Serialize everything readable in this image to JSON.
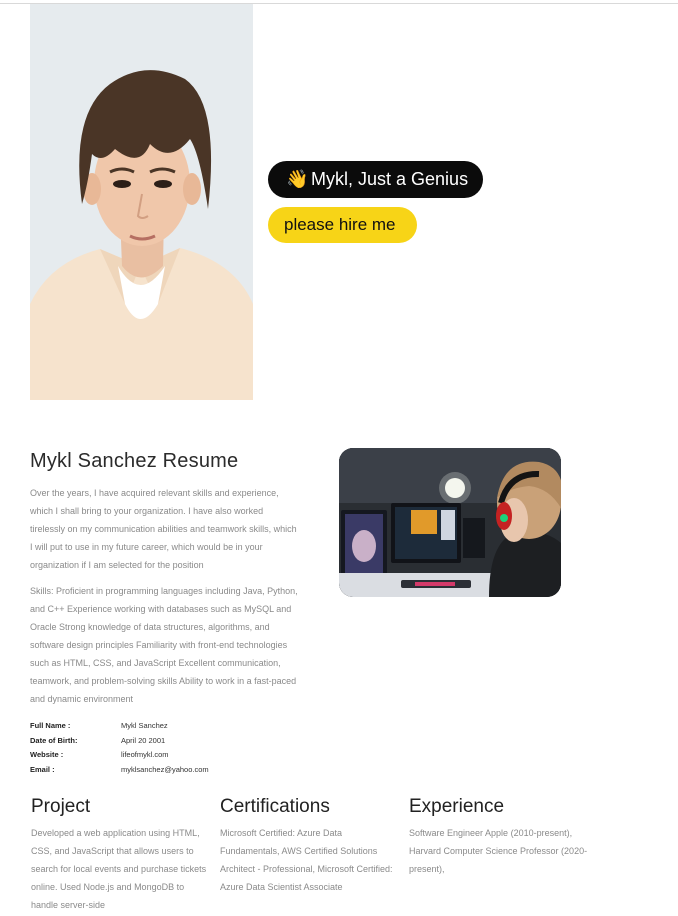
{
  "hero": {
    "portrait_icon": "portrait-photo",
    "greeting_emoji": "👋",
    "greeting_label": "Mykl, Just a Genius",
    "cta_label": "please hire me"
  },
  "resume": {
    "title": "Mykl Sanchez Resume",
    "intro": "Over the years, I have acquired relevant skills and experience, which I shall bring to your organization. I have also worked tirelessly on my communication abilities and teamwork skills, which I will put to use in my future career, which would be in your organization if I am selected for the position",
    "skills": "Skills: Proficient in programming languages including Java, Python, and C++ Experience working with databases such as MySQL and Oracle Strong knowledge of data structures, algorithms, and software design principles Familiarity with front-end technologies such as HTML, CSS, and JavaScript Excellent communication, teamwork, and problem-solving skills Ability to work in a fast-paced and dynamic environment",
    "photo_icon": "gaming-setup-photo"
  },
  "info": [
    {
      "label": "Full Name :",
      "value": "Mykl Sanchez"
    },
    {
      "label": "Date of Birth:",
      "value": "April 20 2001"
    },
    {
      "label": "Website :",
      "value": "lifeofmykl.com"
    },
    {
      "label": "Email :",
      "value": "myklsanchez@yahoo.com"
    }
  ],
  "sections": {
    "project": {
      "title": "Project",
      "text": "Developed a web application using HTML, CSS, and JavaScript that allows users to search for local events and purchase tickets online. Used Node.js and MongoDB to handle server-side"
    },
    "certifications": {
      "title": "Certifications",
      "text": "Microsoft Certified: Azure Data Fundamentals, AWS Certified Solutions Architect - Professional, Microsoft Certified: Azure Data Scientist Associate"
    },
    "experience": {
      "title": "Experience",
      "text": "Software Engineer Apple (2010-present), Harvard Computer Science Professor (2020-present),"
    }
  },
  "colors": {
    "dark_pill": "#0b0b0b",
    "yellow_pill": "#f7d417",
    "body_text": "#8a8a8a"
  }
}
